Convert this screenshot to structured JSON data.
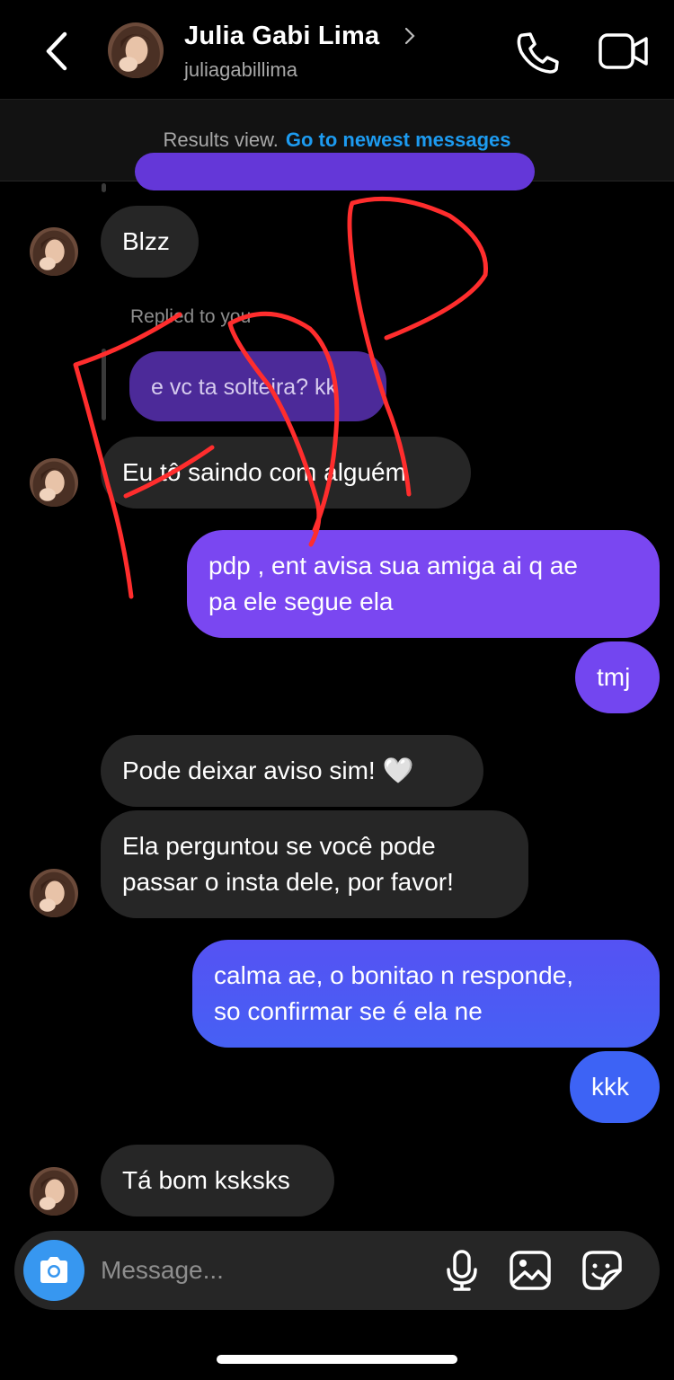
{
  "header": {
    "name": "Julia Gabi Lima",
    "username": "juliagabillima"
  },
  "banner": {
    "prefix": "Results view.",
    "link": "Go to newest messages"
  },
  "messages": [
    {
      "side": "in",
      "text": "Blzz"
    },
    {
      "side": "in",
      "replied_label": "Replied to you",
      "quoted": "e vc ta solteira? kk",
      "text": "Eu tô saindo com alguém"
    },
    {
      "side": "out",
      "text_line1": "pdp , ent avisa sua amiga ai q ae",
      "text_line2": "pa ele segue ela"
    },
    {
      "side": "out",
      "text": "tmj"
    },
    {
      "side": "in",
      "text": "Pode deixar aviso sim! 🤍"
    },
    {
      "side": "in",
      "text_line1": "Ela perguntou se você pode",
      "text_line2": "passar o insta dele, por favor!"
    },
    {
      "side": "out",
      "text_line1": "calma ae, o bonitao n responde,",
      "text_line2": "so confirmar se é ela ne"
    },
    {
      "side": "out",
      "text": "kkk"
    },
    {
      "side": "in",
      "text": "Tá bom ksksks"
    }
  ],
  "composer": {
    "placeholder": "Message..."
  },
  "colors": {
    "background": "#000000",
    "incoming_bubble": "#262626",
    "outgoing_purple": "#7a47f1",
    "outgoing_blue": "#3d63f5",
    "link_blue": "#1d9bf0",
    "scribble_red": "#ff2d2d"
  },
  "icons": [
    "back-chevron-icon",
    "chevron-right-icon",
    "phone-icon",
    "video-camera-icon",
    "camera-icon",
    "microphone-icon",
    "gallery-icon",
    "sticker-icon"
  ]
}
